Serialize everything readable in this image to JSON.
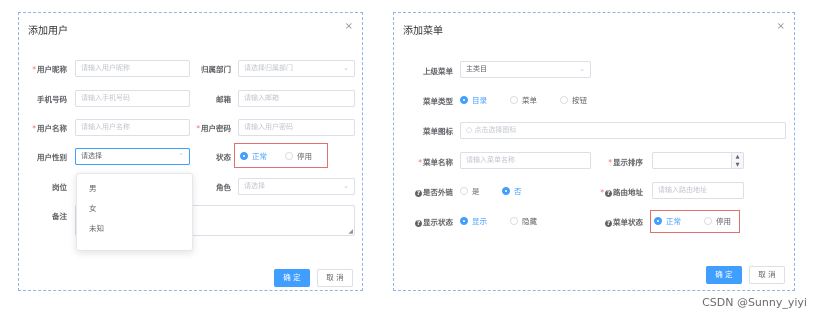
{
  "dialog_user": {
    "title": "添加用户",
    "close": "×",
    "labels": {
      "nickname": "用户昵称",
      "dept": "归属部门",
      "phone": "手机号码",
      "email": "邮箱",
      "username": "用户名称",
      "password": "用户密码",
      "gender": "用户性别",
      "status": "状态",
      "post": "岗位",
      "role": "角色",
      "remark": "备注"
    },
    "placeholders": {
      "nickname": "请输入用户昵称",
      "dept": "请选择归属部门",
      "phone": "请输入手机号码",
      "email": "请输入邮箱",
      "username": "请输入用户名称",
      "password": "请输入用户密码",
      "gender": "请选择",
      "role": "请选择"
    },
    "status_options": [
      "正常",
      "停用"
    ],
    "status_selected": "正常",
    "gender_options": [
      "男",
      "女",
      "未知"
    ],
    "confirm": "确 定",
    "cancel": "取 消"
  },
  "dialog_menu": {
    "title": "添加菜单",
    "close": "×",
    "labels": {
      "parent": "上级菜单",
      "type": "菜单类型",
      "icon": "菜单图标",
      "name": "菜单名称",
      "sort": "显示排序",
      "external": "是否外链",
      "path": "路由地址",
      "visible": "显示状态",
      "status": "菜单状态"
    },
    "parent_value": "主类目",
    "type_options": [
      "目录",
      "菜单",
      "按钮"
    ],
    "type_selected": "目录",
    "icon_placeholder": "点击选择图标",
    "name_placeholder": "请输入菜单名称",
    "path_placeholder": "请输入路由地址",
    "external_options": [
      "是",
      "否"
    ],
    "external_selected": "否",
    "visible_options": [
      "显示",
      "隐藏"
    ],
    "visible_selected": "显示",
    "status_options": [
      "正常",
      "停用"
    ],
    "status_selected": "正常",
    "confirm": "确 定",
    "cancel": "取 消"
  },
  "watermark": "CSDN @Sunny_yiyi",
  "colors": {
    "primary": "#409eff",
    "highlight_box": "#e46f6f",
    "required": "#f56c6c"
  }
}
